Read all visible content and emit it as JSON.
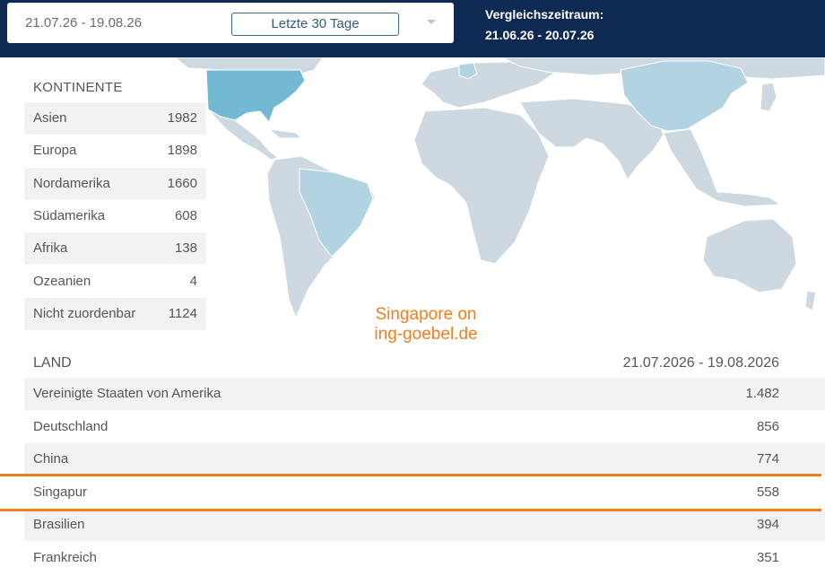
{
  "header": {
    "date_range": "21.07.26 - 19.08.26",
    "preset": "Letzte 30 Tage",
    "compare_label": "Vergleichszeitraum:",
    "compare_range": "21.06.26 - 20.07.26"
  },
  "continents": {
    "header": "KONTINENTE",
    "rows": [
      {
        "name": "Asien",
        "value": "1982"
      },
      {
        "name": "Europa",
        "value": "1898"
      },
      {
        "name": "Nordamerika",
        "value": "1660"
      },
      {
        "name": "Südamerika",
        "value": "608"
      },
      {
        "name": "Afrika",
        "value": "138"
      },
      {
        "name": "Ozeanien",
        "value": "4"
      },
      {
        "name": "Nicht zuordenbar",
        "value": "1124"
      }
    ]
  },
  "watermark": {
    "line1": "Singapore on",
    "line2": "ing-goebel.de"
  },
  "countries": {
    "header_label": "LAND",
    "header_period": "21.07.2026 - 19.08.2026",
    "rows": [
      {
        "name": "Vereinigte Staaten von Amerika",
        "value": "1.482"
      },
      {
        "name": "Deutschland",
        "value": "856"
      },
      {
        "name": "China",
        "value": "774"
      },
      {
        "name": "Singapur",
        "value": "558"
      },
      {
        "name": "Brasilien",
        "value": "394"
      },
      {
        "name": "Frankreich",
        "value": "351"
      }
    ]
  },
  "colors": {
    "header_bg": "#0f2a52",
    "map_land": "#ced8e0",
    "map_highlight_strong": "#74b9d4",
    "map_highlight_light": "#b2d3e1",
    "highlight_orange": "#f07f1e"
  }
}
